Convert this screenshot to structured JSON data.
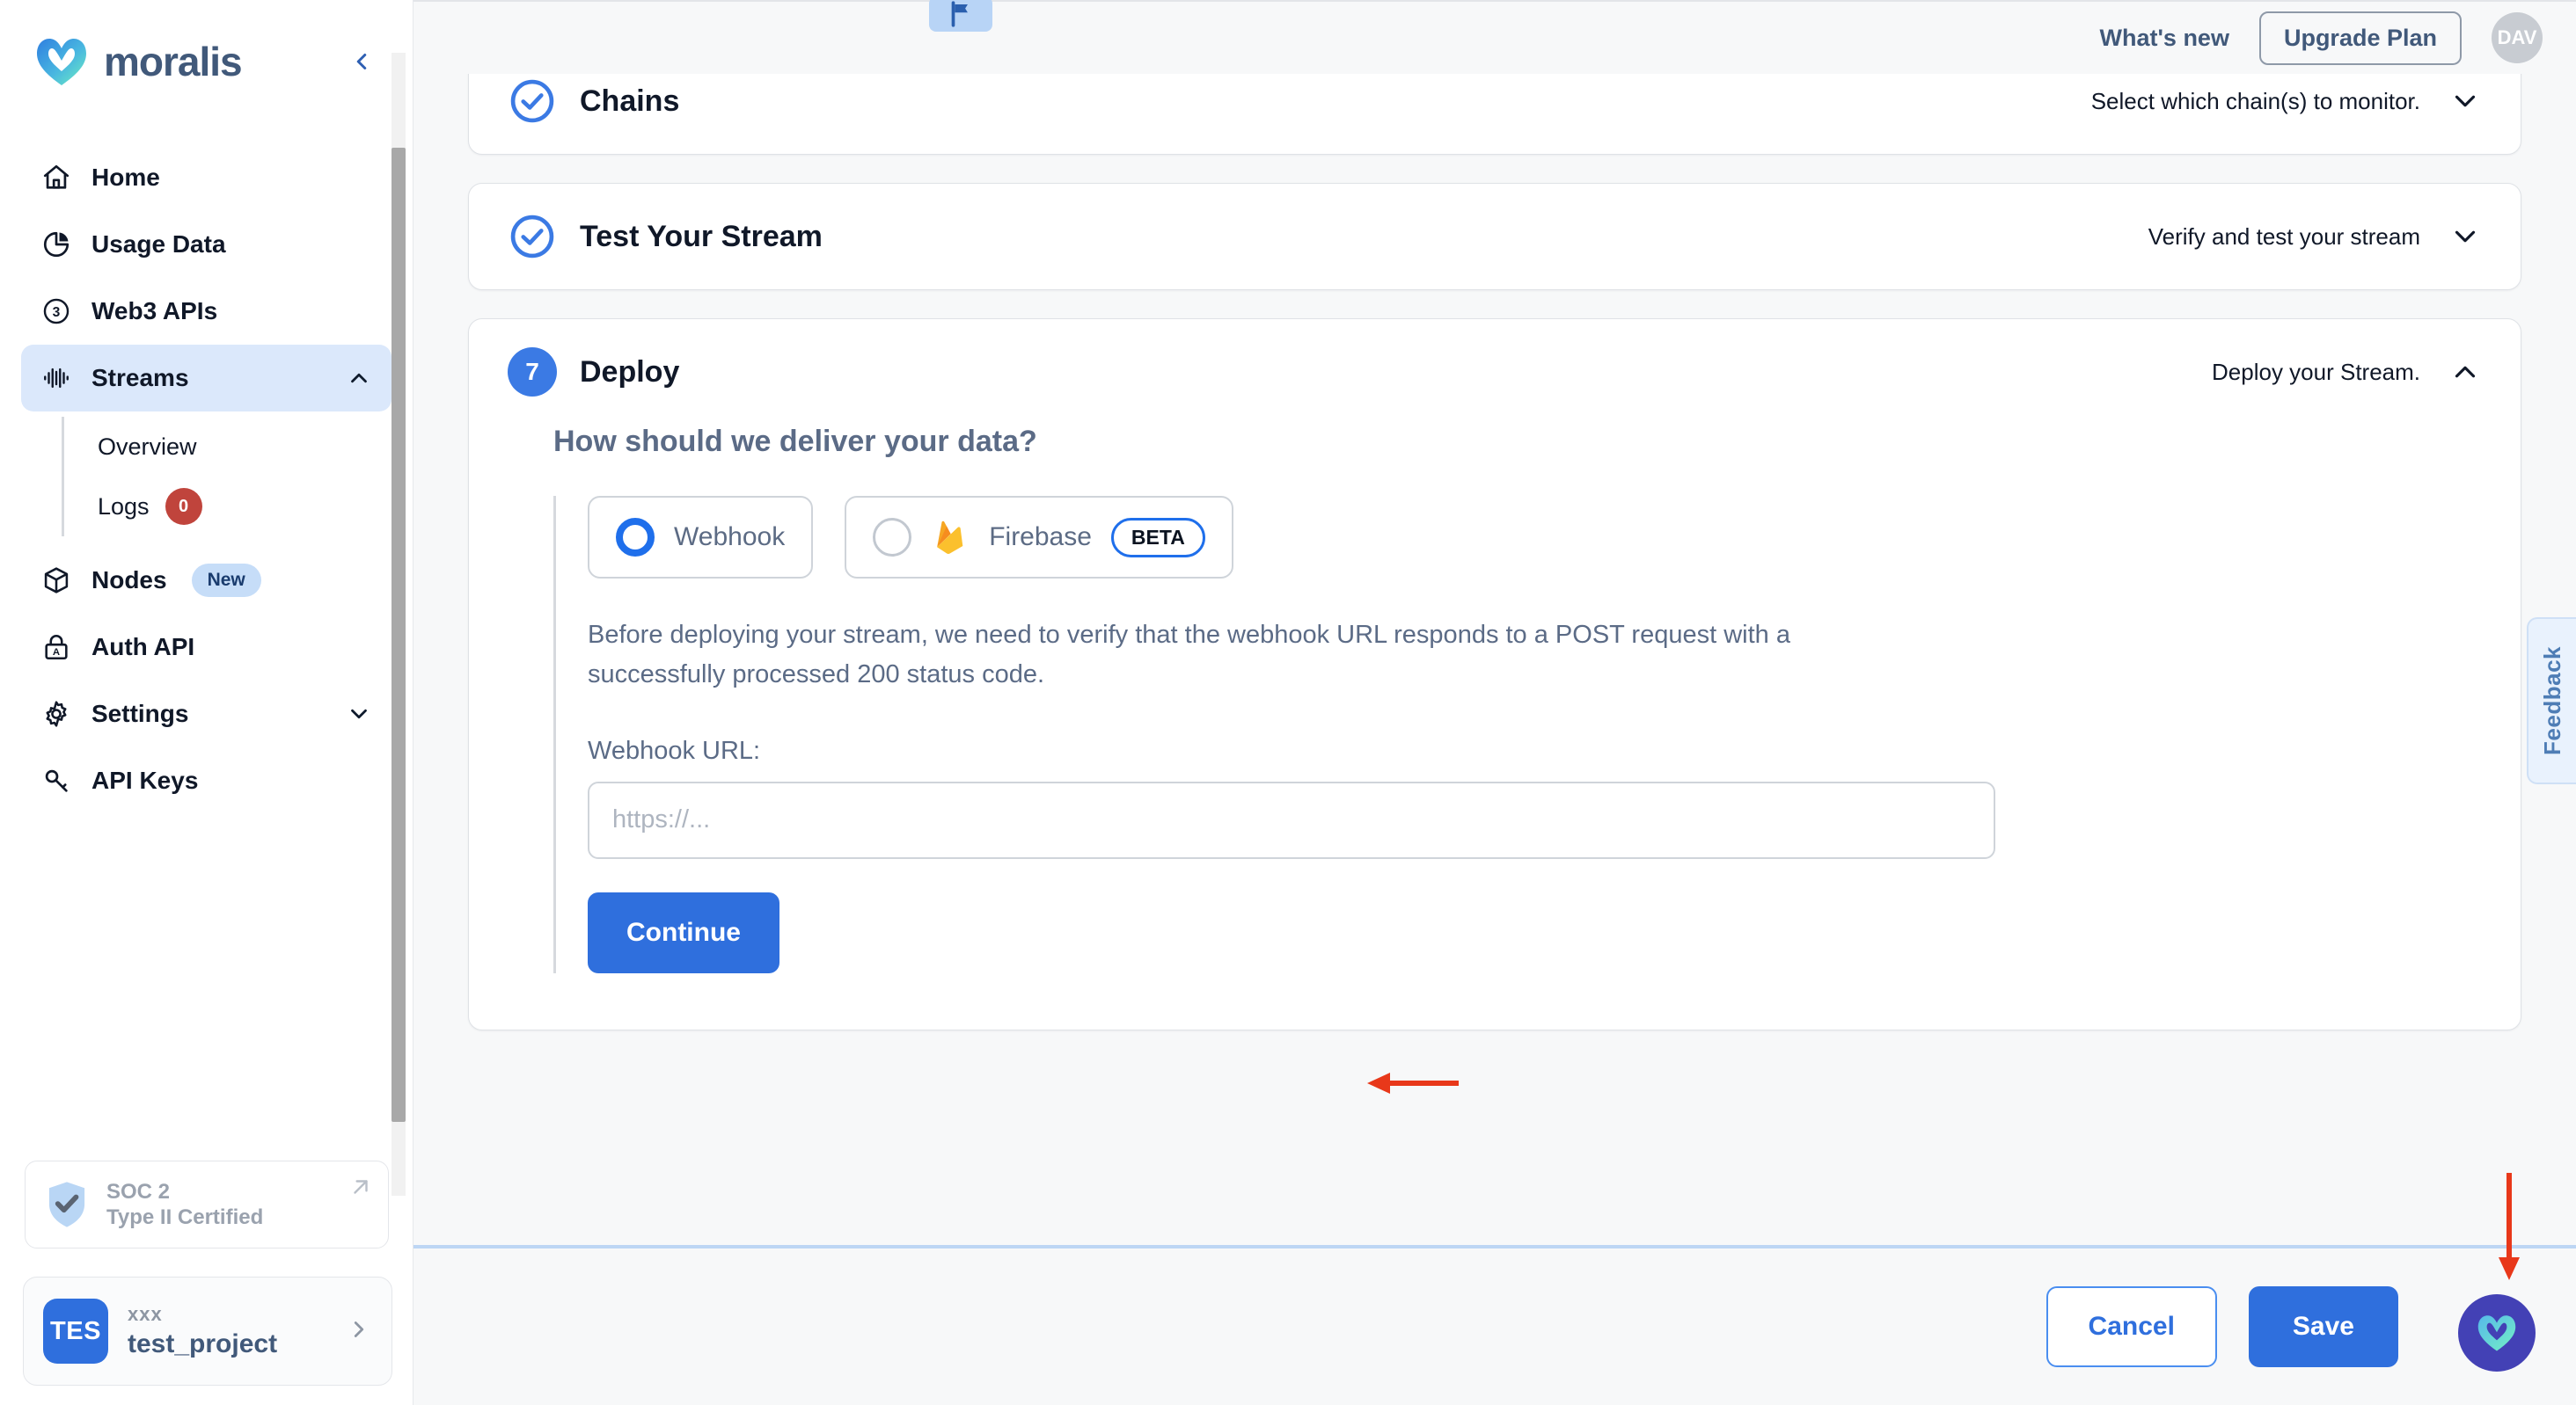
{
  "sidebar": {
    "brand": "moralis",
    "collapse_icon": "chevron-left-icon",
    "items": [
      {
        "label": "Home",
        "icon": "home-icon"
      },
      {
        "label": "Usage Data",
        "icon": "pie-chart-icon"
      },
      {
        "label": "Web3 APIs",
        "icon": "circle-three-icon"
      },
      {
        "label": "Streams",
        "icon": "waveform-icon",
        "expanded": true,
        "chevron": "chevron-up-icon"
      },
      {
        "label": "Nodes",
        "icon": "cube-icon",
        "badge": "New"
      },
      {
        "label": "Auth API",
        "icon": "lock-a-icon"
      },
      {
        "label": "Settings",
        "icon": "gear-icon",
        "chevron": "chevron-down-icon"
      },
      {
        "label": "API Keys",
        "icon": "key-icon"
      }
    ],
    "streams_subitems": [
      {
        "label": "Overview"
      },
      {
        "label": "Logs",
        "count": "0"
      }
    ],
    "soc_card": {
      "icon": "shield-check-icon",
      "line1": "SOC 2",
      "line2": "Type II Certified",
      "external_icon": "external-link-icon"
    },
    "project_card": {
      "avatar_initials": "TES",
      "org": "xxx",
      "name": "test_project",
      "chevron": "chevron-right-icon"
    }
  },
  "topbar": {
    "flag_icon": "flag-icon",
    "whats_new": "What's new",
    "upgrade_label": "Upgrade Plan",
    "avatar_initials": "DAV"
  },
  "steps": [
    {
      "id": "chains",
      "state": "complete",
      "status_icon": "check-circle-icon",
      "title": "Chains",
      "hint": "Select which chain(s) to monitor.",
      "chevron": "chevron-down-icon"
    },
    {
      "id": "test-your-stream",
      "state": "complete",
      "status_icon": "check-circle-icon",
      "title": "Test Your Stream",
      "hint": "Verify and test your stream",
      "chevron": "chevron-down-icon"
    },
    {
      "id": "deploy",
      "state": "active",
      "number": "7",
      "title": "Deploy",
      "hint": "Deploy your Stream.",
      "chevron": "chevron-up-icon"
    }
  ],
  "deploy": {
    "question": "How should we deliver your data?",
    "options": [
      {
        "id": "webhook",
        "label": "Webhook",
        "selected": true
      },
      {
        "id": "firebase",
        "label": "Firebase",
        "selected": false,
        "icon": "firebase-icon",
        "badge": "BETA"
      }
    ],
    "description": "Before deploying your stream, we need to verify that the webhook URL responds to a POST request with a successfully processed 200 status code.",
    "url_label": "Webhook URL:",
    "url_value": "",
    "url_placeholder": "https://...",
    "continue_label": "Continue"
  },
  "footer": {
    "cancel_label": "Cancel",
    "save_label": "Save",
    "chat_icon": "moralis-chat-icon"
  },
  "feedback": {
    "label": "Feedback"
  },
  "annotations": {
    "color": "#e8381a",
    "arrow_continue": "arrow-pointing-left-at-continue",
    "arrow_save": "arrow-pointing-down-at-save"
  }
}
